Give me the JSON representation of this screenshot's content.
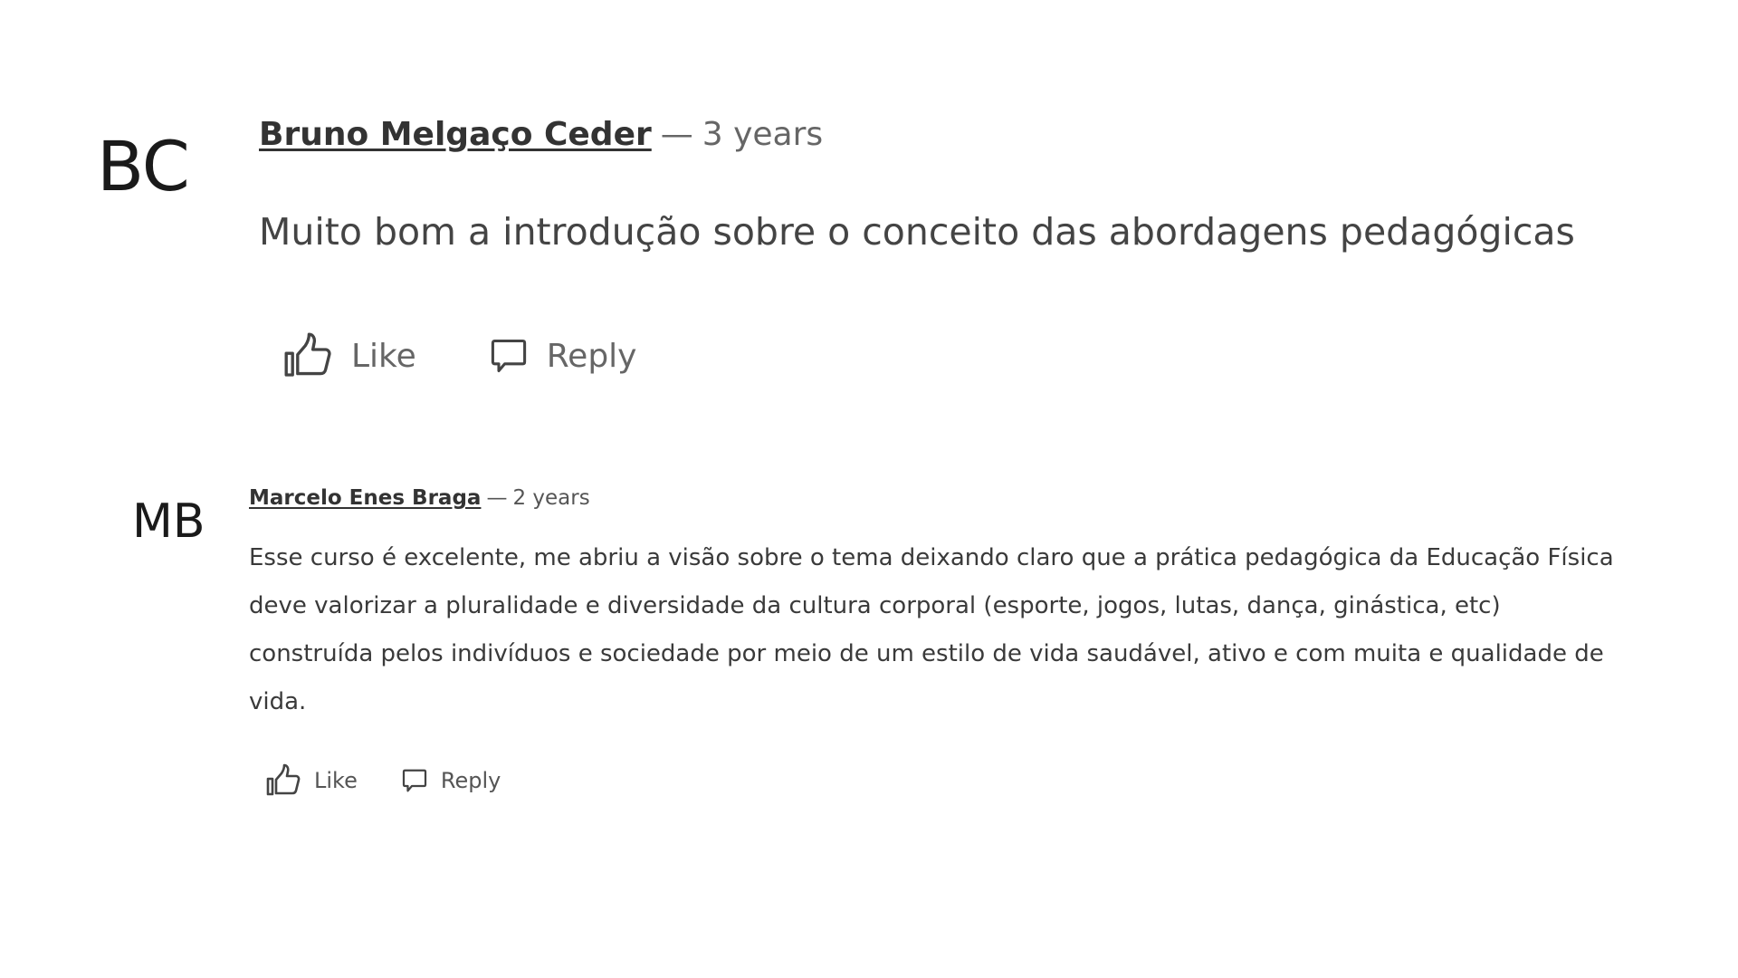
{
  "comments": [
    {
      "initials": "BC",
      "author": "Bruno Melgaço Ceder",
      "separator": "—",
      "age": "3 years",
      "text": "Muito bom a introdução sobre o conceito das abordagens pedagógicas",
      "like_label": "Like",
      "reply_label": "Reply"
    },
    {
      "initials": "MB",
      "author": "Marcelo Enes Braga",
      "separator": "—",
      "age": "2 years",
      "text": "Esse curso é excelente, me abriu a visão sobre o tema deixando claro que a prática pedagógica da Educação Física deve valorizar a pluralidade e diversidade da cultura corporal (esporte, jogos, lutas, dança, ginástica, etc) construída pelos indivíduos e sociedade por meio de um estilo de vida saudável, ativo e com muita e qualidade de vida.",
      "like_label": "Like",
      "reply_label": "Reply"
    }
  ],
  "icons": {
    "like": "thumbs-up-icon",
    "reply": "speech-bubble-icon"
  },
  "colors": {
    "background": "#ffffff",
    "text": "#333333",
    "muted": "#666666"
  }
}
